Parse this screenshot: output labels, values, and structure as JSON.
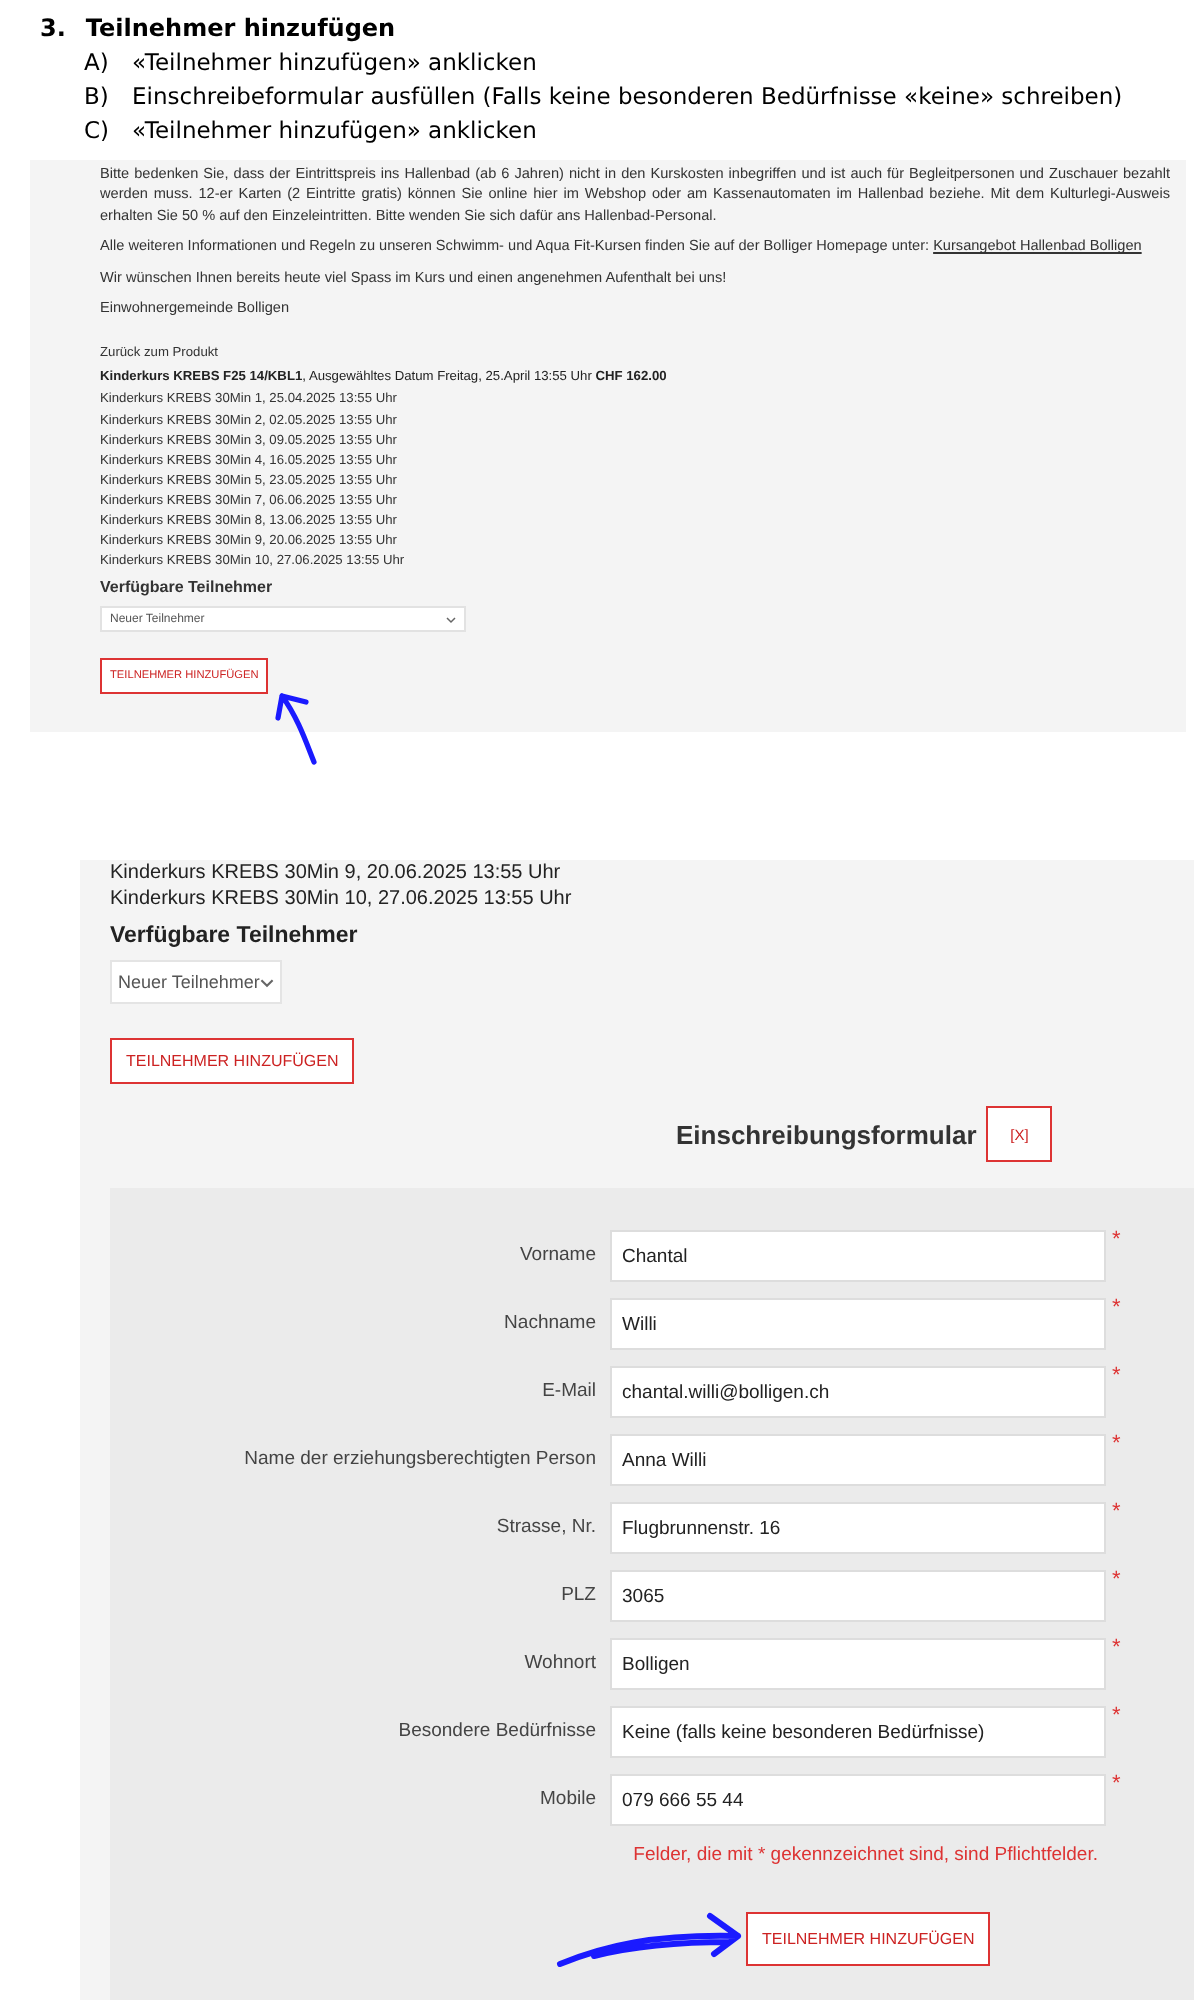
{
  "instructions": {
    "number": "3.",
    "title": "Teilnehmer hinzufügen",
    "steps": [
      {
        "letter": "A)",
        "text": "«Teilnehmer hinzufügen» anklicken"
      },
      {
        "letter": "B)",
        "text": "Einschreibeformular ausfüllen (Falls keine besonderen Bedürfnisse «keine» schreiben)"
      },
      {
        "letter": "C)",
        "text": "«Teilnehmer hinzufügen» anklicken"
      }
    ]
  },
  "screenshot_1": {
    "paragraphs": [
      {
        "text": "Bitte bedenken Sie, dass der Eintrittspreis ins Hallenbad (ab 6 Jahren) nicht in den Kurskosten inbegriffen und ist auch für Begleitpersonen und Zuschauer bezahlt werden muss. 12-er Karten (2 Eintritte gratis) können Sie online hier im Webshop oder am Kassenautomaten im Hallenbad beziehe. Mit dem Kulturlegi-Ausweis erhalten Sie 50 % auf den Einzeleintritten. Bitte wenden Sie sich dafür ans Hallenbad-Personal."
      },
      {
        "text": "Alle weiteren Informationen und Regeln zu unseren Schwimm- und Aqua Fit-Kursen finden Sie auf der Bolliger Homepage unter: ",
        "link": "Kursangebot Hallenbad Bolligen"
      },
      {
        "text": "Wir wünschen Ihnen bereits heute viel Spass im Kurs und einen angenehmen Aufenthalt bei uns!"
      },
      {
        "text": "Einwohnergemeinde Bolligen"
      }
    ],
    "back_link": "Zurück zum Produkt",
    "product": {
      "name": "Kinderkurs KREBS F25 14/KBL1",
      "detail": ", Ausgewähltes Datum Freitag, 25.April 13:55 Uhr",
      "price": "CHF 162.00"
    },
    "sessions": [
      "Kinderkurs KREBS 30Min 1, 25.04.2025 13:55 Uhr",
      "Kinderkurs KREBS 30Min 2, 02.05.2025 13:55 Uhr",
      "Kinderkurs KREBS 30Min 3, 09.05.2025 13:55 Uhr",
      "Kinderkurs KREBS 30Min 4, 16.05.2025 13:55 Uhr",
      "Kinderkurs KREBS 30Min 5, 23.05.2025 13:55 Uhr",
      "Kinderkurs KREBS 30Min 7, 06.06.2025 13:55 Uhr",
      "Kinderkurs KREBS 30Min 8, 13.06.2025 13:55 Uhr",
      "Kinderkurs KREBS 30Min 9, 20.06.2025 13:55 Uhr",
      "Kinderkurs KREBS 30Min 10, 27.06.2025 13:55 Uhr"
    ],
    "participants_heading": "Verfügbare Teilnehmer",
    "select": {
      "value": "Neuer Teilnehmer"
    },
    "add_button": "TEILNEHMER HINZUFÜGEN"
  },
  "screenshot_2": {
    "sessions": [
      "Kinderkurs KREBS 30Min 9, 20.06.2025 13:55 Uhr",
      "Kinderkurs KREBS 30Min 10, 27.06.2025 13:55 Uhr"
    ],
    "participants_heading": "Verfügbare Teilnehmer",
    "select": {
      "value": "Neuer Teilnehmer"
    },
    "add_button": "TEILNEHMER HINZUFÜGEN",
    "form": {
      "title": "Einschreibungsformular",
      "close_button": "[X]",
      "fields": [
        {
          "label": "Vorname",
          "value": "Chantal",
          "required_mark": "*"
        },
        {
          "label": "Nachname",
          "value": "Willi",
          "required_mark": "*"
        },
        {
          "label": "E-Mail",
          "value": "chantal.willi@bolligen.ch",
          "required_mark": "*"
        },
        {
          "label": "Name der erziehungsberechtigten Person",
          "value": "Anna Willi",
          "required_mark": "*"
        },
        {
          "label": "Strasse, Nr.",
          "value": "Flugbrunnenstr. 16",
          "required_mark": "*"
        },
        {
          "label": "PLZ",
          "value": "3065",
          "required_mark": "*"
        },
        {
          "label": "Wohnort",
          "value": "Bolligen",
          "required_mark": "*"
        },
        {
          "label": "Besondere Bedürfnisse",
          "value": "Keine (falls keine besonderen Bedürfnisse)",
          "required_mark": "*"
        },
        {
          "label": "Mobile",
          "value": "079 666 55 44",
          "required_mark": "*"
        }
      ],
      "note": "Felder, die mit * gekennzeichnet sind, sind Pflichtfelder.",
      "submit_button": "TEILNEHMER HINZUFÜGEN"
    }
  }
}
